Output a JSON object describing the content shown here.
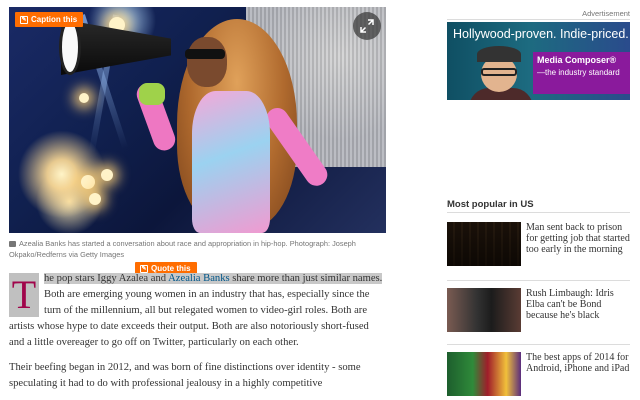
{
  "hero": {
    "caption_badge": "Caption this",
    "icons": {
      "badge": "caption-icon",
      "expand": "expand-icon"
    }
  },
  "caption": {
    "text": "Azealia Banks has started a conversation about race and appropriation in hip-hop. Photograph: Joseph Okpako/Redferns via Getty Images"
  },
  "quote_badge": "Quote this",
  "article": {
    "dropcap": "T",
    "p1_hl": "he pop stars Iggy Azalea and ",
    "p1_link": "Azealia Banks",
    "p1_hl2": " share more than just similar names.",
    "p1_rest": " Both are emerging young women in an industry that has, especially since the turn of the millennium, all but relegated women to video-girl roles. Both are artists whose hype to date exceeds their output. Both are also notoriously short-fused and a little overeager to go off on Twitter, particularly on each other.",
    "p2": "Their beefing began in 2012, and was born of fine distinctions over identity - some speculating it had to do with professional jealousy in a highly competitive"
  },
  "sidebar": {
    "ad_label": "Advertisement",
    "ad": {
      "headline": "Hollywood-proven. Indie-priced.",
      "product": "Media Composer®",
      "tagline": "—the industry standard"
    },
    "popular_title": "Most popular in US",
    "items": [
      {
        "headline": "Man sent back to prison for getting job that started too early in the morning"
      },
      {
        "headline": "Rush Limbaugh: Idris Elba can't be Bond because he's black"
      },
      {
        "headline": "The best apps of 2014 for Android, iPhone and iPad"
      }
    ]
  },
  "colors": {
    "badge": "#ff6d00",
    "link": "#005689",
    "dropcap": "#a0054b",
    "ad_box": "#8a1a9c"
  }
}
